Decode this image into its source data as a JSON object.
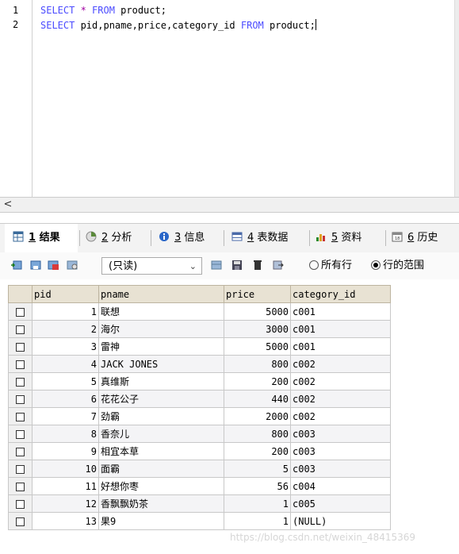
{
  "editor": {
    "lines": [
      {
        "num": "1",
        "parts": [
          [
            "kw",
            "SELECT"
          ],
          [
            "",
            ""
          ],
          [
            "op",
            " *"
          ],
          [
            "kw",
            " FROM"
          ],
          [
            "",
            " product;"
          ]
        ]
      },
      {
        "num": "2",
        "parts": [
          [
            "kw",
            "SELECT"
          ],
          [
            "",
            " pid,pname,price,category_id"
          ],
          [
            "kw",
            " FROM"
          ],
          [
            "",
            " product;"
          ]
        ]
      }
    ],
    "scroll_left_glyph": "<"
  },
  "tabs": [
    {
      "num": "1",
      "label": "结果",
      "icon": "grid-result-icon"
    },
    {
      "num": "2",
      "label": "分析",
      "icon": "chart-analysis-icon"
    },
    {
      "num": "3",
      "label": "信息",
      "icon": "info-icon"
    },
    {
      "num": "4",
      "label": "表数据",
      "icon": "table-data-icon"
    },
    {
      "num": "5",
      "label": "资料",
      "icon": "profile-icon"
    },
    {
      "num": "6",
      "label": "历史",
      "icon": "history-icon"
    }
  ],
  "toolbar": {
    "mode_value": "(只读)",
    "radio_all": "所有行",
    "radio_range": "行的范围",
    "radio_selected": "radio_range"
  },
  "grid": {
    "columns": [
      "pid",
      "pname",
      "price",
      "category_id"
    ],
    "rows": [
      [
        "1",
        "联想",
        "5000",
        "c001"
      ],
      [
        "2",
        "海尔",
        "3000",
        "c001"
      ],
      [
        "3",
        "雷神",
        "5000",
        "c001"
      ],
      [
        "4",
        "JACK JONES",
        "800",
        "c002"
      ],
      [
        "5",
        "真维斯",
        "200",
        "c002"
      ],
      [
        "6",
        "花花公子",
        "440",
        "c002"
      ],
      [
        "7",
        "劲霸",
        "2000",
        "c002"
      ],
      [
        "8",
        "香奈儿",
        "800",
        "c003"
      ],
      [
        "9",
        "相宜本草",
        "200",
        "c003"
      ],
      [
        "10",
        "面霸",
        "5",
        "c003"
      ],
      [
        "11",
        "好想你枣",
        "56",
        "c004"
      ],
      [
        "12",
        "香飘飘奶茶",
        "1",
        "c005"
      ],
      [
        "13",
        "果9",
        "1",
        "(NULL)"
      ]
    ]
  },
  "watermark": "https://blog.csdn.net/weixin_48415369"
}
